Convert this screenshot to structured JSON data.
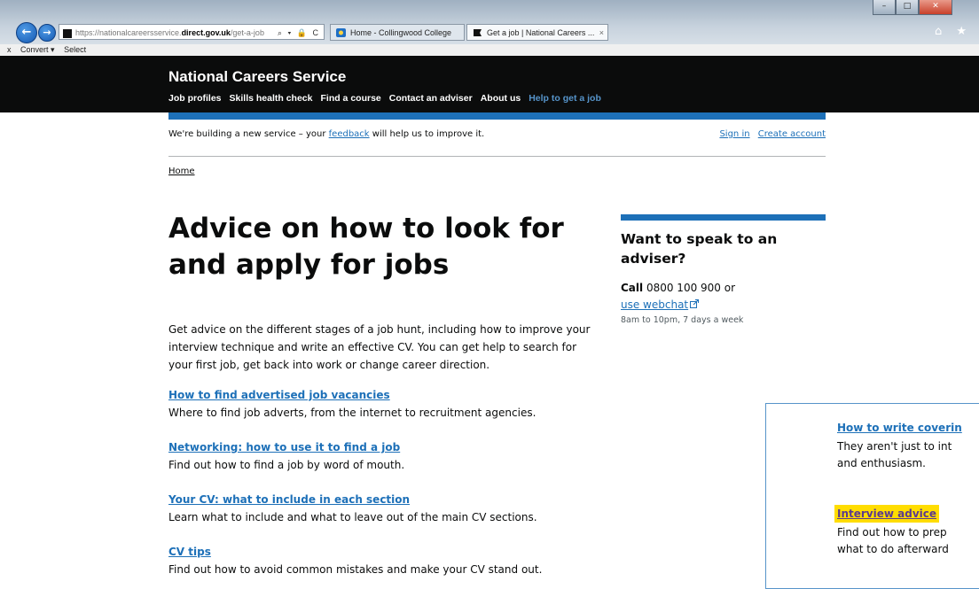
{
  "browser": {
    "address": {
      "prefix": "https://",
      "subdomain": "nationalcareersservice.",
      "domain": "direct.gov.uk",
      "path": "/get-a-job",
      "tools": "⌕ ▾ 🔒 C"
    },
    "tabs": [
      {
        "label": "Home - Collingwood College",
        "icon_color": "#1f6fc5"
      },
      {
        "label": "Get a job | National Careers ...",
        "icon_color": "#111111"
      }
    ],
    "tab_close": "×",
    "window_controls": [
      "–",
      "□",
      "✕"
    ],
    "chrome_icons": "⌂ ★",
    "command_bar": {
      "close": "x",
      "convert": "Convert ▾",
      "select": "Select"
    }
  },
  "site": {
    "brand": "National Careers Service",
    "nav": [
      {
        "label": "Job profiles"
      },
      {
        "label": "Skills health check"
      },
      {
        "label": "Find a course"
      },
      {
        "label": "Contact an adviser"
      },
      {
        "label": "About us"
      },
      {
        "label": "Help to get a job",
        "current": true
      }
    ]
  },
  "phase": {
    "text_before": "We're building a new service – your ",
    "feedback_link": "feedback",
    "text_after": " will help us to improve it.",
    "sign_in": "Sign in",
    "create_account": "Create account"
  },
  "breadcrumb": {
    "home": "Home"
  },
  "page": {
    "title": "Advice on how to look for and apply for jobs",
    "lede": "Get advice on the different stages of a job hunt, including how to improve your interview technique and write an effective CV. You can get help to search for your first job, get back into work or change career direction.",
    "items": [
      {
        "link": "How to find advertised job vacancies",
        "desc": "Where to find job adverts, from the internet to recruitment agencies."
      },
      {
        "link": "Networking: how to use it to find a job",
        "desc": "Find out how to find a job by word of mouth."
      },
      {
        "link": "Your CV: what to include in each section",
        "desc": "Learn what to include and what to leave out of the main CV sections."
      },
      {
        "link": "CV tips",
        "desc": "Find out how to avoid common mistakes and make your CV stand out."
      }
    ]
  },
  "adviser": {
    "title": "Want to speak to an adviser?",
    "call_label": "Call",
    "phone": " 0800 100 900 or",
    "webchat": "use webchat",
    "hours": "8am to 10pm, 7 days a week"
  },
  "panel": {
    "items": [
      {
        "link": "How to write coverin",
        "desc_lines": [
          "They aren't just to int",
          "and enthusiasm."
        ]
      },
      {
        "link": "Interview advice",
        "desc_lines": [
          "Find out how to prep",
          "what to do afterward"
        ],
        "focused": true
      }
    ]
  }
}
